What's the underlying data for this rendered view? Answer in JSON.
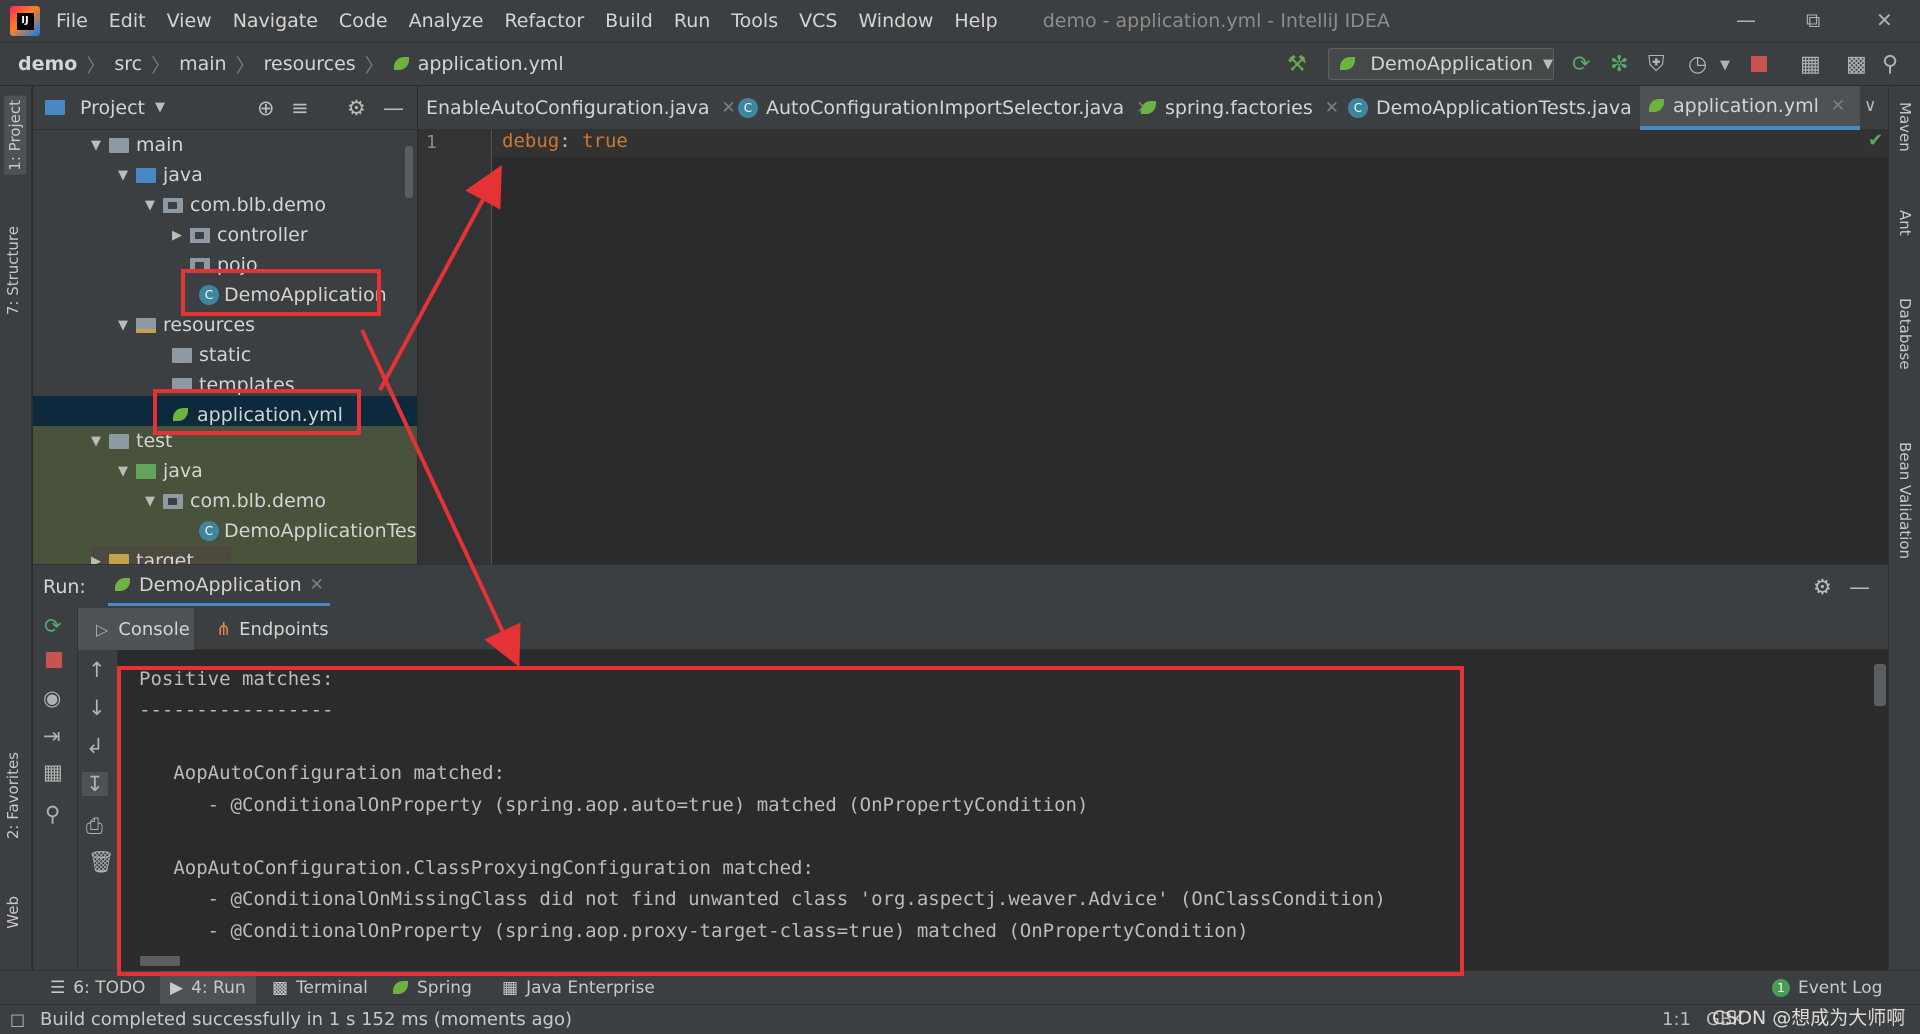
{
  "menu": {
    "items": [
      "File",
      "Edit",
      "View",
      "Navigate",
      "Code",
      "Analyze",
      "Refactor",
      "Build",
      "Run",
      "Tools",
      "VCS",
      "Window",
      "Help"
    ],
    "window_title": "demo - application.yml - IntelliJ IDEA"
  },
  "breadcrumb": [
    "demo",
    "src",
    "main",
    "resources",
    "application.yml"
  ],
  "run_config": "DemoApplication",
  "left_stripe": {
    "project": "1: Project",
    "structure": "7: Structure",
    "favorites": "2: Favorites",
    "web": "Web"
  },
  "right_stripe": {
    "maven": "Maven",
    "ant": "Ant",
    "database": "Database",
    "bean": "Bean Validation"
  },
  "project": {
    "title": "Project",
    "tree": [
      {
        "label": "main"
      },
      {
        "label": "java"
      },
      {
        "label": "com.blb.demo"
      },
      {
        "label": "controller"
      },
      {
        "label": "pojo"
      },
      {
        "label": "DemoApplication"
      },
      {
        "label": "resources"
      },
      {
        "label": "static"
      },
      {
        "label": "templates"
      },
      {
        "label": "application.yml"
      },
      {
        "label": "test"
      },
      {
        "label": "java"
      },
      {
        "label": "com.blb.demo"
      },
      {
        "label": "DemoApplicationTests"
      },
      {
        "label": "target"
      }
    ]
  },
  "editor": {
    "tabs": [
      {
        "label": "EnableAutoConfiguration.java"
      },
      {
        "label": "AutoConfigurationImportSelector.java"
      },
      {
        "label": "spring.factories"
      },
      {
        "label": "DemoApplicationTests.java"
      },
      {
        "label": "application.yml"
      }
    ],
    "line_number": "1",
    "code_key": "debug",
    "code_colon": ":",
    "code_value": "true"
  },
  "run": {
    "label": "Run:",
    "tab": "DemoApplication",
    "subtabs": {
      "console": "Console",
      "endpoints": "Endpoints"
    },
    "console_lines": [
      "Positive matches:",
      "-----------------",
      "",
      "   AopAutoConfiguration matched:",
      "      - @ConditionalOnProperty (spring.aop.auto=true) matched (OnPropertyCondition)",
      "",
      "   AopAutoConfiguration.ClassProxyingConfiguration matched:",
      "      - @ConditionalOnMissingClass did not find unwanted class 'org.aspectj.weaver.Advice' (OnClassCondition)",
      "      - @ConditionalOnProperty (spring.aop.proxy-target-class=true) matched (OnPropertyCondition)"
    ]
  },
  "tool_tabs": {
    "todo": "6: TODO",
    "run": "4: Run",
    "terminal": "Terminal",
    "spring": "Spring",
    "java_ee": "Java Enterprise",
    "event_log": "Event Log",
    "event_count": "1"
  },
  "status": {
    "message": "Build completed successfully in 1 s 152 ms (moments ago)",
    "position": "1:1",
    "encoding": "GBK",
    "watermark": "CSDN @想成为大师啊"
  },
  "colors": {
    "accent": "#4a88c7",
    "annotation": "#e53235",
    "selection": "#0d293e"
  }
}
